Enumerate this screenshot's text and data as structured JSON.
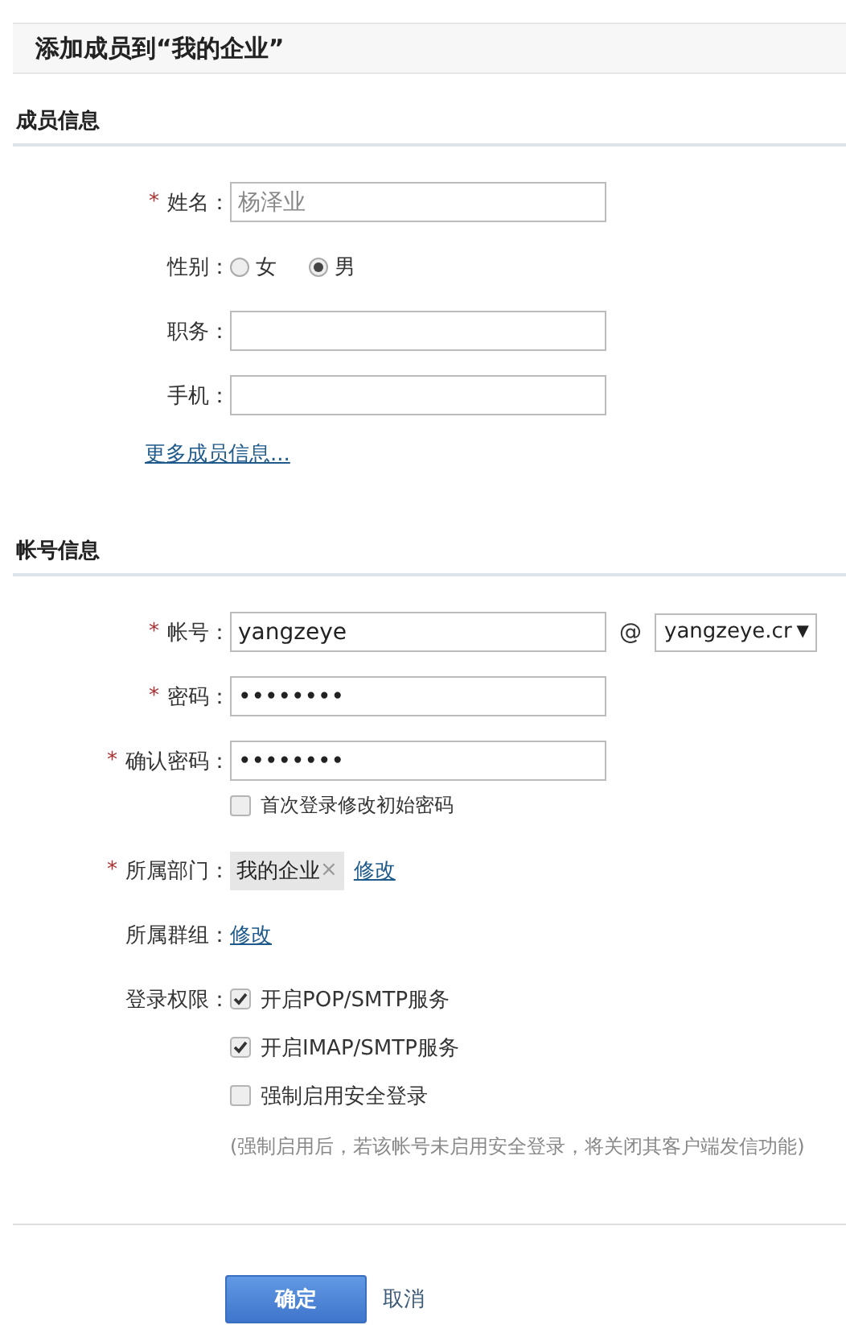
{
  "title": "添加成员到“我的企业”",
  "sections": [
    {
      "heading": "成员信息",
      "rows": [
        {
          "kind": "text",
          "required_mark": "*",
          "label": "姓名：",
          "placeholder": "杨泽业"
        },
        {
          "kind": "radio",
          "label": "性别：",
          "options": [
            {
              "label": "女",
              "selected": false
            },
            {
              "label": "男",
              "selected": true
            }
          ]
        },
        {
          "kind": "text",
          "label": "职务："
        },
        {
          "kind": "text",
          "label": "手机："
        },
        {
          "kind": "link",
          "link": "更多成员信息..."
        }
      ]
    },
    {
      "heading": "帐号信息",
      "rows": [
        {
          "kind": "account",
          "required_mark": "*",
          "label": "帐号：",
          "value": "yangzeye",
          "at": "@",
          "domain": "yangzeye.cr",
          "caret": "▼"
        },
        {
          "kind": "text",
          "required_mark": "*",
          "label": "密码：",
          "value": "••••••••"
        },
        {
          "kind": "text",
          "required_mark": "*",
          "label": "确认密码：",
          "value": "••••••••"
        },
        {
          "kind": "checkbox",
          "options": [
            {
              "label": "首次登录修改初始密码",
              "checked": false
            }
          ]
        },
        {
          "kind": "tag",
          "required_mark": "*",
          "label": "所属部门：",
          "tag": "我的企业",
          "remove": "×",
          "link": "修改"
        },
        {
          "kind": "link",
          "label": "所属群组：",
          "link": "修改"
        },
        {
          "kind": "checkbox",
          "label": "登录权限：",
          "options": [
            {
              "label": "开启POP/SMTP服务",
              "checked": true
            },
            {
              "label": "开启IMAP/SMTP服务",
              "checked": true
            },
            {
              "label": "强制启用安全登录",
              "checked": false
            }
          ],
          "note": "(强制启用后，若该帐号未启用安全登录，将关闭其客户端发信功能)"
        }
      ]
    }
  ],
  "buttons": [
    {
      "kind": "primary",
      "label": "确定"
    },
    {
      "kind": "plain",
      "label": "取消"
    }
  ]
}
